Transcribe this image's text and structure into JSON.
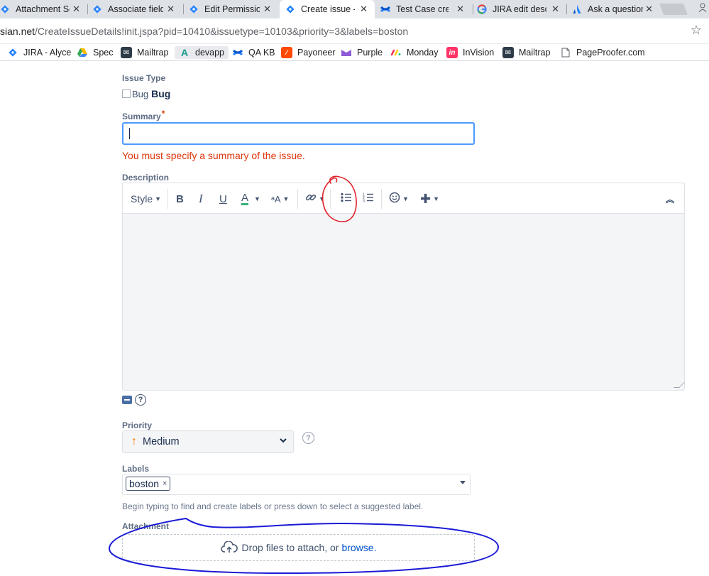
{
  "browser": {
    "tabs": [
      {
        "title": "Attachment Se",
        "favicon": "jira-diamond-icon",
        "active": false
      },
      {
        "title": "Associate field",
        "favicon": "jira-diamond-icon",
        "active": false
      },
      {
        "title": "Edit Permission",
        "favicon": "jira-diamond-icon",
        "active": false
      },
      {
        "title": "Create issue -",
        "favicon": "jira-diamond-icon",
        "active": true
      },
      {
        "title": "Test Case crea",
        "favicon": "confluence-icon",
        "active": false
      },
      {
        "title": "JIRA edit desc",
        "favicon": "google-g-icon",
        "active": false
      },
      {
        "title": "Ask a question",
        "favicon": "atlassian-icon",
        "active": false
      }
    ],
    "close_glyph": "✕",
    "url_host_tail": "sian.net",
    "url_path": "/CreateIssueDetails!init.jspa?pid=10410&issuetype=10103&priority=3&labels=boston",
    "bookmarks": [
      {
        "label": "JIRA - Alyce",
        "icon": "jira-diamond-icon"
      },
      {
        "label": "Spec",
        "icon": "google-drive-icon"
      },
      {
        "label": "Mailtrap",
        "icon": "mailtrap-icon"
      },
      {
        "label": "devapp",
        "icon": "letter-a-icon"
      },
      {
        "label": "QA KB",
        "icon": "confluence-icon"
      },
      {
        "label": "Payoneer",
        "icon": "payoneer-icon"
      },
      {
        "label": "Purple",
        "icon": "purple-icon"
      },
      {
        "label": "Monday",
        "icon": "monday-icon"
      },
      {
        "label": "InVision",
        "icon": "invision-icon"
      },
      {
        "label": "Mailtrap",
        "icon": "mailtrap-icon"
      },
      {
        "label": "PageProofer.com",
        "icon": "page-icon"
      }
    ]
  },
  "form": {
    "issue_type": {
      "label": "Issue Type",
      "icon_alt": "Bug",
      "value": "Bug"
    },
    "summary": {
      "label": "Summary",
      "required_mark": "*",
      "value": "",
      "error": "You must specify a summary of the issue."
    },
    "description": {
      "label": "Description",
      "toolbar": {
        "style_label": "Style",
        "bold": "B",
        "italic": "I",
        "underline": "U",
        "text_color": "A",
        "more_formatting": "ᵃA"
      }
    },
    "priority": {
      "label": "Priority",
      "value": "Medium",
      "arrow_glyph": "↑",
      "priority_color": "#ff7a00"
    },
    "labels": {
      "label": "Labels",
      "tag": "boston",
      "remove_glyph": "×",
      "hint": "Begin typing to find and create labels or press down to select a suggested label."
    },
    "attachment": {
      "label": "Attachment",
      "drop_text": "Drop files to attach, or",
      "browse_text": "browse."
    }
  },
  "colors": {
    "error": "#de350b",
    "focus": "#4c9aff",
    "link": "#0052cc",
    "annotation_red": "#e0242c",
    "annotation_blue": "#1a1ad6"
  }
}
